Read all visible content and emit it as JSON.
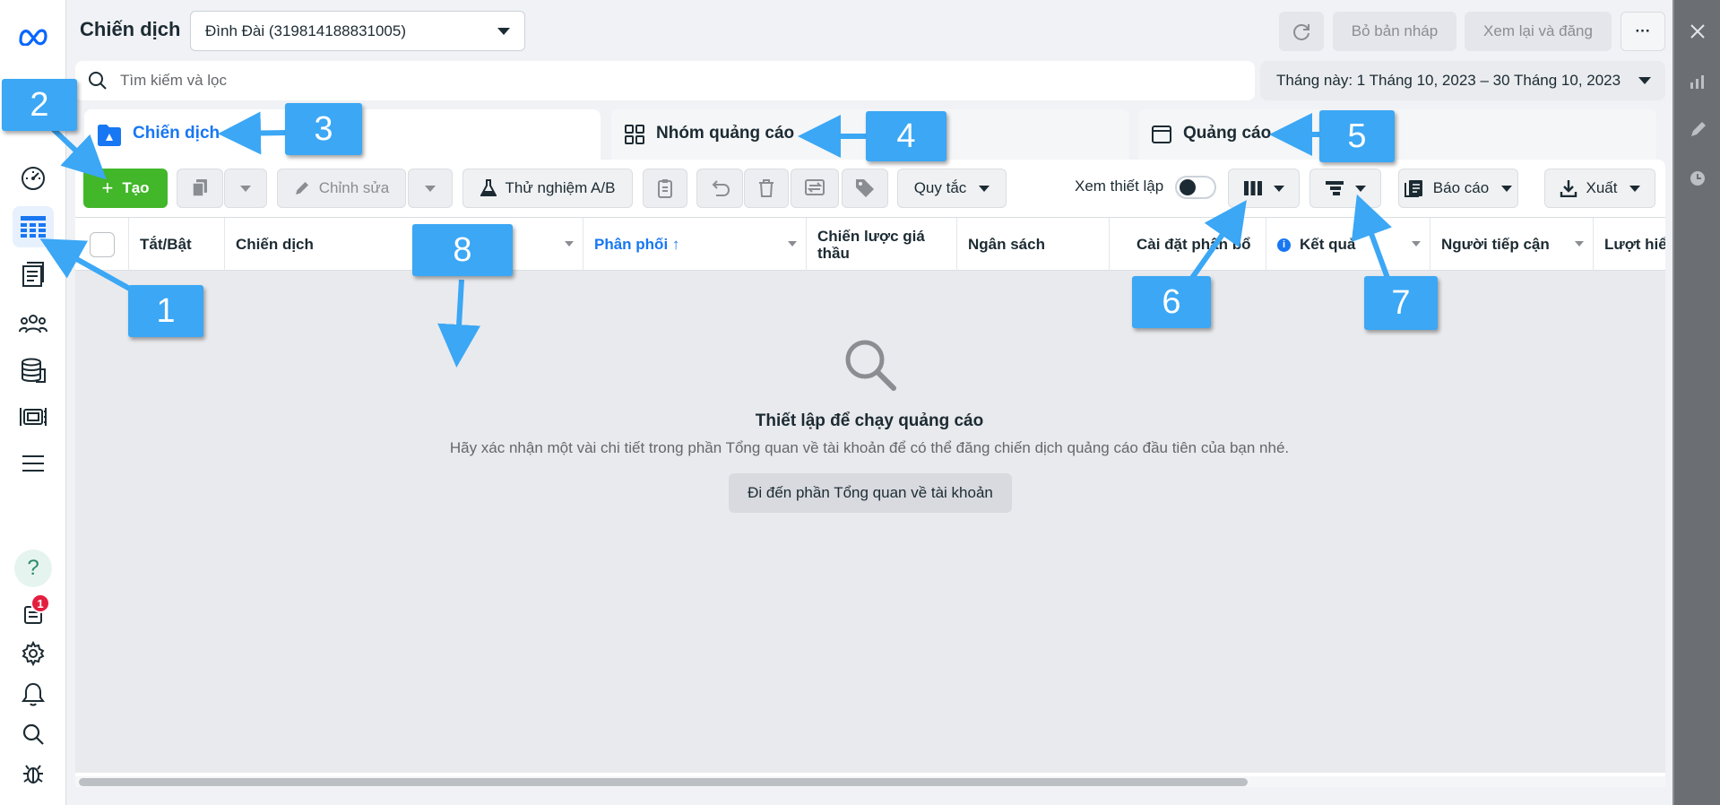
{
  "header": {
    "title": "Chiến dịch",
    "account": "Đình Đài (319814188831005)",
    "discard_label": "Bỏ bản nháp",
    "review_label": "Xem lại và đăng",
    "more_label": "···"
  },
  "search": {
    "placeholder": "Tìm kiếm và lọc"
  },
  "date_range": "Tháng này: 1 Tháng 10, 2023 – 30 Tháng 10, 2023",
  "tabs": [
    {
      "label": "Chiến dịch"
    },
    {
      "label": "Nhóm quảng cáo"
    },
    {
      "label": "Quảng cáo"
    }
  ],
  "toolbar": {
    "create_label": "Tạo",
    "edit_label": "Chỉnh sửa",
    "ab_test_label": "Thử nghiệm A/B",
    "rules_label": "Quy tắc",
    "view_setup_label": "Xem thiết lập",
    "report_label": "Báo cáo",
    "export_label": "Xuất"
  },
  "table": {
    "columns": [
      "Tắt/Bật",
      "Chiến dịch",
      "Phân phối ↑",
      "Chiến lược giá thầu",
      "Ngân sách",
      "Cài đặt phân bổ",
      "Kết quả",
      "Người tiếp cận",
      "Lượt hiển thị"
    ]
  },
  "empty_state": {
    "title": "Thiết lập để chạy quảng cáo",
    "description": "Hãy xác nhận một vài chi tiết trong phần Tổng quan về tài khoản để có thể đăng chiến dịch quảng cáo đầu tiên của bạn nhé.",
    "button_label": "Đi đến phần Tổng quan về tài khoản"
  },
  "nav": {
    "notification_count": "1"
  },
  "callouts": [
    "1",
    "2",
    "3",
    "4",
    "5",
    "6",
    "7",
    "8"
  ],
  "colors": {
    "accent": "#1877f2",
    "create_green": "#42b72a",
    "callout_blue": "#3ba7f5",
    "badge_red": "#e41e3f"
  },
  "icons": [
    "meta-logo-icon",
    "dashboard-icon",
    "campaigns-table-icon",
    "pages-icon",
    "audiences-icon",
    "database-icon",
    "media-icon",
    "menu-icon",
    "help-icon",
    "notifications-icon",
    "settings-icon",
    "bell-icon",
    "search-icon",
    "bug-icon"
  ]
}
